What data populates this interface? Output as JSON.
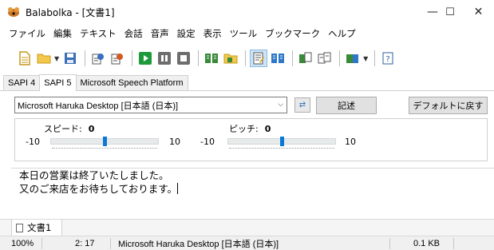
{
  "window": {
    "title": "Balabolka - [文書1]",
    "minimize": "—",
    "maximize": "☐",
    "close": "✕"
  },
  "menu": [
    "ファイル",
    "編集",
    "テキスト",
    "会話",
    "音声",
    "設定",
    "表示",
    "ツール",
    "ブックマーク",
    "ヘルプ"
  ],
  "toolbar": {
    "icons": [
      "new-document-icon",
      "open-folder-icon",
      "save-icon",
      "speak-file-icon",
      "save-audio-icon",
      "play-icon",
      "pause-icon",
      "stop-icon",
      "read-clipboard-icon",
      "read-file-icon",
      "edit-icon",
      "spell-check-icon",
      "split-file-icon",
      "join-files-icon",
      "audio-options-icon",
      "help-icon"
    ]
  },
  "tabs": [
    {
      "label": "SAPI 4",
      "active": false
    },
    {
      "label": "SAPI 5",
      "active": true
    },
    {
      "label": "Microsoft Speech Platform",
      "active": false
    }
  ],
  "voice": {
    "selected": "Microsoft Haruka Desktop [日本語 (日本)]",
    "describe_button": "記述",
    "default_button": "デフォルトに戻す"
  },
  "sliders": {
    "speed": {
      "label": "スピード:",
      "value": "0",
      "min": "-10",
      "max": "10",
      "fraction": 0.5
    },
    "pitch": {
      "label": "ピッチ:",
      "value": "0",
      "min": "-10",
      "max": "10",
      "fraction": 0.5
    }
  },
  "editor": {
    "lines": [
      "本日の営業は終了いたしました。",
      "又のご来店をお待ちしております。"
    ]
  },
  "document_tab": {
    "label": "文書1"
  },
  "status": {
    "zoom": "100%",
    "position": "2:  17",
    "voice": "Microsoft Haruka Desktop [日本語 (日本)]",
    "size": "0.1 KB"
  },
  "colors": {
    "accent": "#0a78d7",
    "play_green": "#1e9a3a"
  }
}
